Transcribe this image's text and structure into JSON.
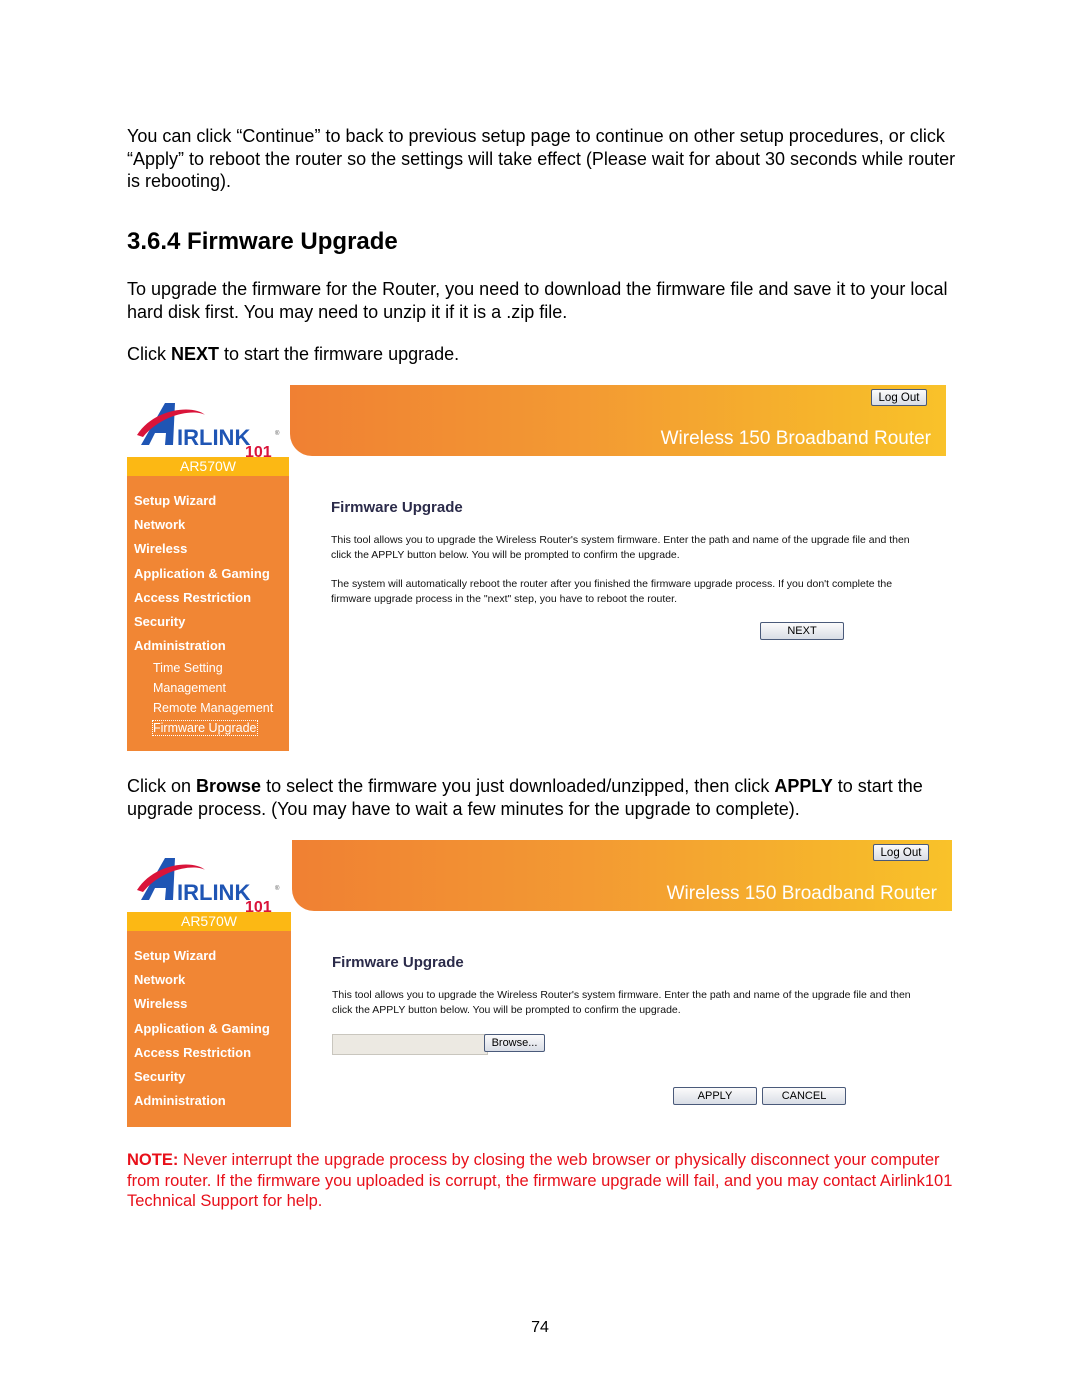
{
  "doc": {
    "intro_paragraph": "You can click “Continue” to back to previous setup page to continue on other setup procedures, or click “Apply” to reboot the router so the settings will take effect (Please wait for about 30 seconds while router is rebooting).",
    "section_title": "3.6.4 Firmware Upgrade",
    "upgrade_paragraph": "To upgrade the firmware for the Router, you need to download the firmware file and save it to your local hard disk first. You may need to unzip it if it is a .zip file.",
    "click_next": {
      "pre": "Click ",
      "bold": "NEXT",
      "post": " to start the firmware upgrade."
    },
    "browse_paragraph": {
      "pre": "Click on ",
      "bold1": "Browse",
      "mid": " to select the firmware you just downloaded/unzipped, then click ",
      "bold2": "APPLY",
      "post": " to start the upgrade process. (You may have to wait a few minutes for the upgrade to complete)."
    },
    "note": {
      "label": "NOTE:",
      "text": " Never interrupt the upgrade process by closing the web browser or physically disconnect your computer from router. If the firmware you uploaded is corrupt, the firmware upgrade will fail, and you may contact Airlink101 Technical Support for help."
    },
    "page_number": "74"
  },
  "router_ui": {
    "brand": {
      "logo_text": "IRLINK",
      "logo_number": "101",
      "model": "AR570W"
    },
    "banner_title": "Wireless 150 Broadband Router",
    "logout_label": "Log Out",
    "menu": [
      "Setup Wizard",
      "Network",
      "Wireless",
      "Application & Gaming",
      "Access Restriction",
      "Security",
      "Administration"
    ],
    "admin_submenu": [
      "Time Setting",
      "Management",
      "Remote Management",
      "Firmware Upgrade"
    ],
    "selected_submenu": "Firmware Upgrade",
    "colors": {
      "menu_bg": "#f18634",
      "model_bar": "#fcb814",
      "note_red": "#e8101a"
    },
    "screen1": {
      "heading": "Firmware Upgrade",
      "text1": "This tool allows you to upgrade the Wireless Router's system firmware. Enter the path and name of the upgrade file and then click the APPLY button below. You will be prompted to confirm the upgrade.",
      "text2": "The system will automatically reboot the router after you finished the firmware upgrade process. If you don't complete the firmware upgrade process in the \"next\" step, you have to reboot the router.",
      "next_label": "NEXT"
    },
    "screen2": {
      "heading": "Firmware Upgrade",
      "text1": "This tool allows you to upgrade the Wireless Router's system firmware. Enter the path and name of the upgrade file and then click the APPLY button below. You will be prompted to confirm the upgrade.",
      "file_value": "",
      "browse_label": "Browse...",
      "apply_label": "APPLY",
      "cancel_label": "CANCEL"
    }
  }
}
